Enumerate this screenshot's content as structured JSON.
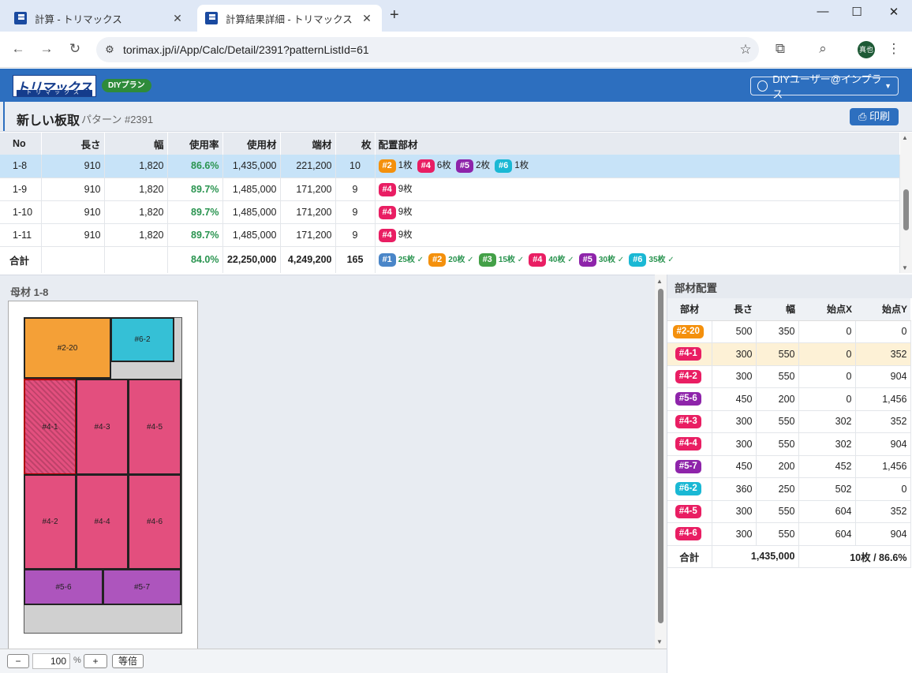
{
  "browser": {
    "tabs": [
      {
        "title": "計算 - トリマックス",
        "active": false
      },
      {
        "title": "計算結果詳細 - トリマックス",
        "active": true
      }
    ],
    "url": "torimax.jp/i/App/Calc/Detail/2391?patternListId=61",
    "profile_initials": "真也"
  },
  "app": {
    "logo_text": "トリマックス",
    "logo_sub": "トリマックス",
    "plan_badge": "DIYプラン",
    "user_label": "DIYユーザー@インプラス"
  },
  "page": {
    "title": "新しい板取",
    "subtitle": "パターン #2391",
    "print_label": "印刷"
  },
  "colors": {
    "#1": "#4a86c8",
    "#2": "#f4900c",
    "#3": "#43a047",
    "#4": "#e91e63",
    "#5": "#8e24aa",
    "#6": "#1ab8d4",
    "accent": "#2d6fbf",
    "selected_row": "#c7e3f8"
  },
  "pattern_table": {
    "headers": [
      "No",
      "長さ",
      "幅",
      "使用率",
      "使用材",
      "端材",
      "枚",
      "配置部材"
    ],
    "rows": [
      {
        "no": "1-8",
        "length": "910",
        "width": "1,820",
        "rate": "86.6%",
        "used": "1,435,000",
        "offcut": "221,200",
        "count": "10",
        "selected": true,
        "parts": [
          {
            "id": "#2",
            "count": "1枚"
          },
          {
            "id": "#4",
            "count": "6枚"
          },
          {
            "id": "#5",
            "count": "2枚"
          },
          {
            "id": "#6",
            "count": "1枚"
          }
        ]
      },
      {
        "no": "1-9",
        "length": "910",
        "width": "1,820",
        "rate": "89.7%",
        "used": "1,485,000",
        "offcut": "171,200",
        "count": "9",
        "selected": false,
        "parts": [
          {
            "id": "#4",
            "count": "9枚"
          }
        ]
      },
      {
        "no": "1-10",
        "length": "910",
        "width": "1,820",
        "rate": "89.7%",
        "used": "1,485,000",
        "offcut": "171,200",
        "count": "9",
        "selected": false,
        "parts": [
          {
            "id": "#4",
            "count": "9枚"
          }
        ]
      },
      {
        "no": "1-11",
        "length": "910",
        "width": "1,820",
        "rate": "89.7%",
        "used": "1,485,000",
        "offcut": "171,200",
        "count": "9",
        "selected": false,
        "parts": [
          {
            "id": "#4",
            "count": "9枚"
          }
        ]
      }
    ],
    "total": {
      "label": "合計",
      "rate": "84.0%",
      "used": "22,250,000",
      "offcut": "4,249,200",
      "count": "165",
      "parts": [
        {
          "id": "#1",
          "count": "25枚 ✓"
        },
        {
          "id": "#2",
          "count": "20枚 ✓"
        },
        {
          "id": "#3",
          "count": "15枚 ✓"
        },
        {
          "id": "#4",
          "count": "40枚 ✓"
        },
        {
          "id": "#5",
          "count": "30枚 ✓"
        },
        {
          "id": "#6",
          "count": "35枚 ✓"
        }
      ]
    }
  },
  "board": {
    "label": "母材 1-8",
    "pieces": [
      "#2-20",
      "#6-2",
      "#4-1",
      "#4-3",
      "#4-5",
      "#4-2",
      "#4-4",
      "#4-6",
      "#5-6",
      "#5-7"
    ]
  },
  "zoom": {
    "minus": "−",
    "value": "100",
    "unit": "%",
    "plus": "+",
    "reset": "等倍"
  },
  "placement": {
    "title": "部材配置",
    "headers": [
      "部材",
      "長さ",
      "幅",
      "始点X",
      "始点Y"
    ],
    "rows": [
      {
        "part": "#2-20",
        "group": "#2",
        "length": "500",
        "width": "350",
        "x": "0",
        "y": "0",
        "highlight": false
      },
      {
        "part": "#4-1",
        "group": "#4",
        "length": "300",
        "width": "550",
        "x": "0",
        "y": "352",
        "highlight": true
      },
      {
        "part": "#4-2",
        "group": "#4",
        "length": "300",
        "width": "550",
        "x": "0",
        "y": "904",
        "highlight": false
      },
      {
        "part": "#5-6",
        "group": "#5",
        "length": "450",
        "width": "200",
        "x": "0",
        "y": "1,456",
        "highlight": false
      },
      {
        "part": "#4-3",
        "group": "#4",
        "length": "300",
        "width": "550",
        "x": "302",
        "y": "352",
        "highlight": false
      },
      {
        "part": "#4-4",
        "group": "#4",
        "length": "300",
        "width": "550",
        "x": "302",
        "y": "904",
        "highlight": false
      },
      {
        "part": "#5-7",
        "group": "#5",
        "length": "450",
        "width": "200",
        "x": "452",
        "y": "1,456",
        "highlight": false
      },
      {
        "part": "#6-2",
        "group": "#6",
        "length": "360",
        "width": "250",
        "x": "502",
        "y": "0",
        "highlight": false
      },
      {
        "part": "#4-5",
        "group": "#4",
        "length": "300",
        "width": "550",
        "x": "604",
        "y": "352",
        "highlight": false
      },
      {
        "part": "#4-6",
        "group": "#4",
        "length": "300",
        "width": "550",
        "x": "604",
        "y": "904",
        "highlight": false
      }
    ],
    "total": {
      "label": "合計",
      "used": "1,435,000",
      "summary": "10枚 / 86.6%"
    }
  }
}
